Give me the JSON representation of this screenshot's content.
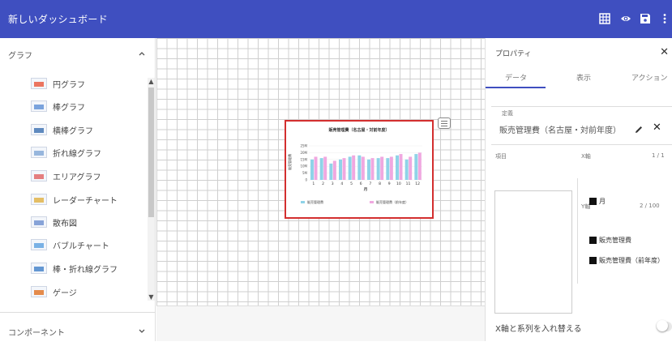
{
  "header": {
    "title": "新しいダッシュボード",
    "icons": [
      "grid-icon",
      "eye-icon",
      "save-icon",
      "more-vert-icon"
    ],
    "color": "#3f4fc0"
  },
  "sidebar": {
    "graph_section": "グラフ",
    "component_section": "コンポーネント",
    "items": [
      {
        "label": "円グラフ",
        "icon": "pie-chart-icon"
      },
      {
        "label": "棒グラフ",
        "icon": "bar-chart-icon"
      },
      {
        "label": "横棒グラフ",
        "icon": "horizontal-bar-chart-icon"
      },
      {
        "label": "折れ線グラフ",
        "icon": "line-chart-icon"
      },
      {
        "label": "エリアグラフ",
        "icon": "area-chart-icon"
      },
      {
        "label": "レーダーチャート",
        "icon": "radar-chart-icon"
      },
      {
        "label": "散布図",
        "icon": "scatter-chart-icon"
      },
      {
        "label": "バブルチャート",
        "icon": "bubble-chart-icon"
      },
      {
        "label": "棒・折れ線グラフ",
        "icon": "bar-line-chart-icon"
      },
      {
        "label": "ゲージ",
        "icon": "gauge-icon"
      }
    ]
  },
  "widget": {
    "chart_data": {
      "type": "bar",
      "title": "販売管理費（名古屋・対前年度）",
      "xlabel": "月",
      "ylabel": "販売管理費",
      "categories": [
        "1",
        "2",
        "3",
        "4",
        "5",
        "6",
        "7",
        "8",
        "9",
        "10",
        "11",
        "12"
      ],
      "yticks": [
        "25M",
        "20M",
        "15M",
        "10M",
        "5M",
        "0"
      ],
      "ylim": [
        0,
        25
      ],
      "series": [
        {
          "name": "販売管理費",
          "color": "#8fd3e8",
          "values": [
            15,
            16,
            12,
            15,
            17,
            18,
            15,
            16,
            16,
            18,
            15,
            19
          ]
        },
        {
          "name": "販売管理費（前年度）",
          "color": "#f0a8e0",
          "values": [
            17,
            17,
            14,
            16,
            18,
            17,
            16,
            17,
            17,
            19,
            17,
            20
          ]
        }
      ]
    }
  },
  "properties": {
    "title": "プロパティ",
    "tabs": [
      "データ",
      "表示",
      "アクション"
    ],
    "definition_label": "定義",
    "definition_value": "販売管理費（名古屋・対前年度）",
    "items_label": "項目",
    "x_axis_label": "X軸",
    "x_axis_count": "1 / 1",
    "x_axis_field": "月",
    "y_axis_label": "Y軸",
    "y_axis_count": "2 / 100",
    "y_axis_fields": [
      "販売管理費",
      "販売管理費（前年度）"
    ],
    "swap_label": "X軸と系列を入れ替える"
  }
}
